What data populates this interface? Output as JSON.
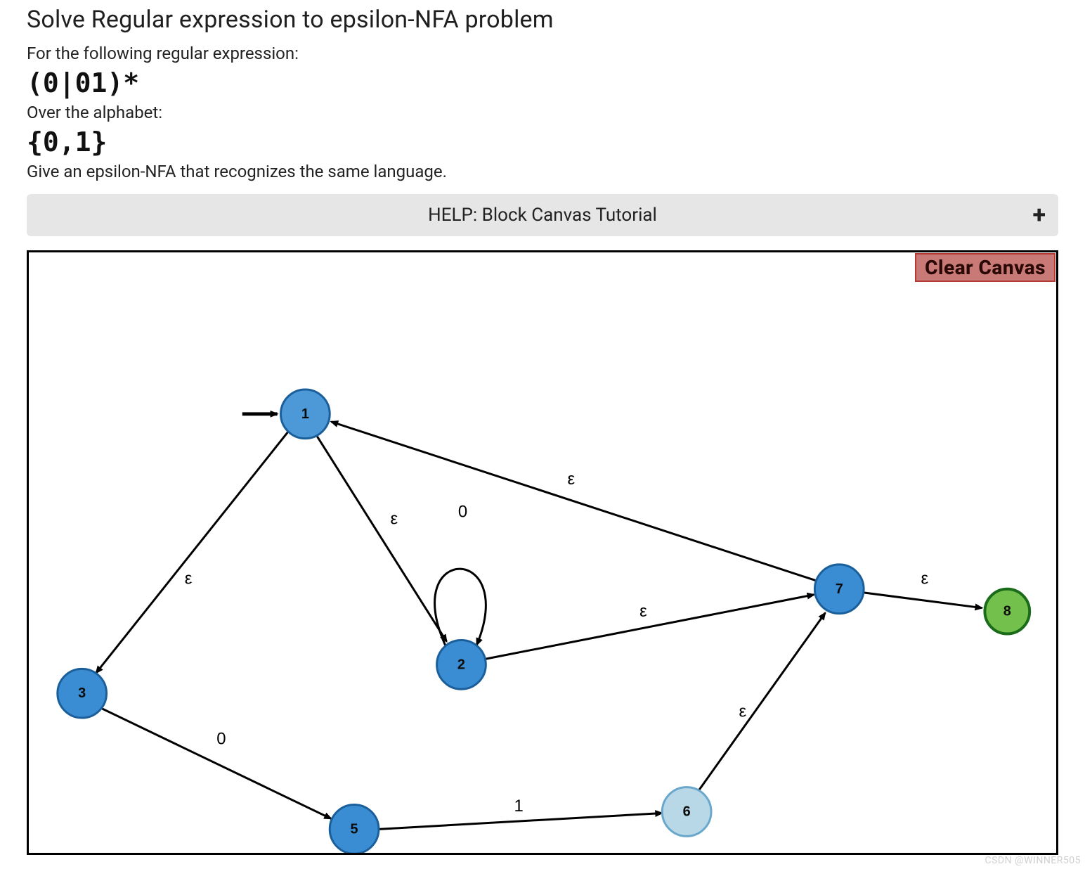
{
  "header": {
    "title": "Solve Regular expression to epsilon-NFA problem",
    "for_line": "For the following regular expression:",
    "regex": "(0|01)*",
    "over_line": "Over the alphabet:",
    "alphabet": "{0,1}",
    "instruction": "Give an epsilon-NFA that recognizes the same language."
  },
  "help": {
    "label": "HELP: Block Canvas Tutorial",
    "expand_icon": "+"
  },
  "canvas": {
    "clear_label": "Clear Canvas"
  },
  "nodes": {
    "n1": {
      "id": "1",
      "color": "#4d99d8",
      "border": "#1b5f9a",
      "is_start": true,
      "is_accept": false
    },
    "n2": {
      "id": "2",
      "color": "#3b8dd3",
      "border": "#1b5f9a",
      "is_start": false,
      "is_accept": false
    },
    "n3": {
      "id": "3",
      "color": "#3b8dd3",
      "border": "#1b5f9a",
      "is_start": false,
      "is_accept": false
    },
    "n5": {
      "id": "5",
      "color": "#3b8dd3",
      "border": "#1b5f9a",
      "is_start": false,
      "is_accept": false
    },
    "n6": {
      "id": "6",
      "color": "#b8d8e8",
      "border": "#6aa7cc",
      "is_start": false,
      "is_accept": false
    },
    "n7": {
      "id": "7",
      "color": "#3b8dd3",
      "border": "#1b5f9a",
      "is_start": false,
      "is_accept": false
    },
    "n8": {
      "id": "8",
      "color": "#73c04c",
      "border": "#1a6b1a",
      "is_start": false,
      "is_accept": true
    }
  },
  "edges": {
    "e1_2": {
      "label": "ε"
    },
    "e1_3": {
      "label": "ε"
    },
    "e2_2": {
      "label": "0"
    },
    "e2_7": {
      "label": "ε"
    },
    "e3_5": {
      "label": "0"
    },
    "e5_6": {
      "label": "1"
    },
    "e6_7": {
      "label": "ε"
    },
    "e7_1": {
      "label": "ε"
    },
    "e7_8": {
      "label": "ε"
    }
  },
  "watermark": "CSDN @WINNER505"
}
